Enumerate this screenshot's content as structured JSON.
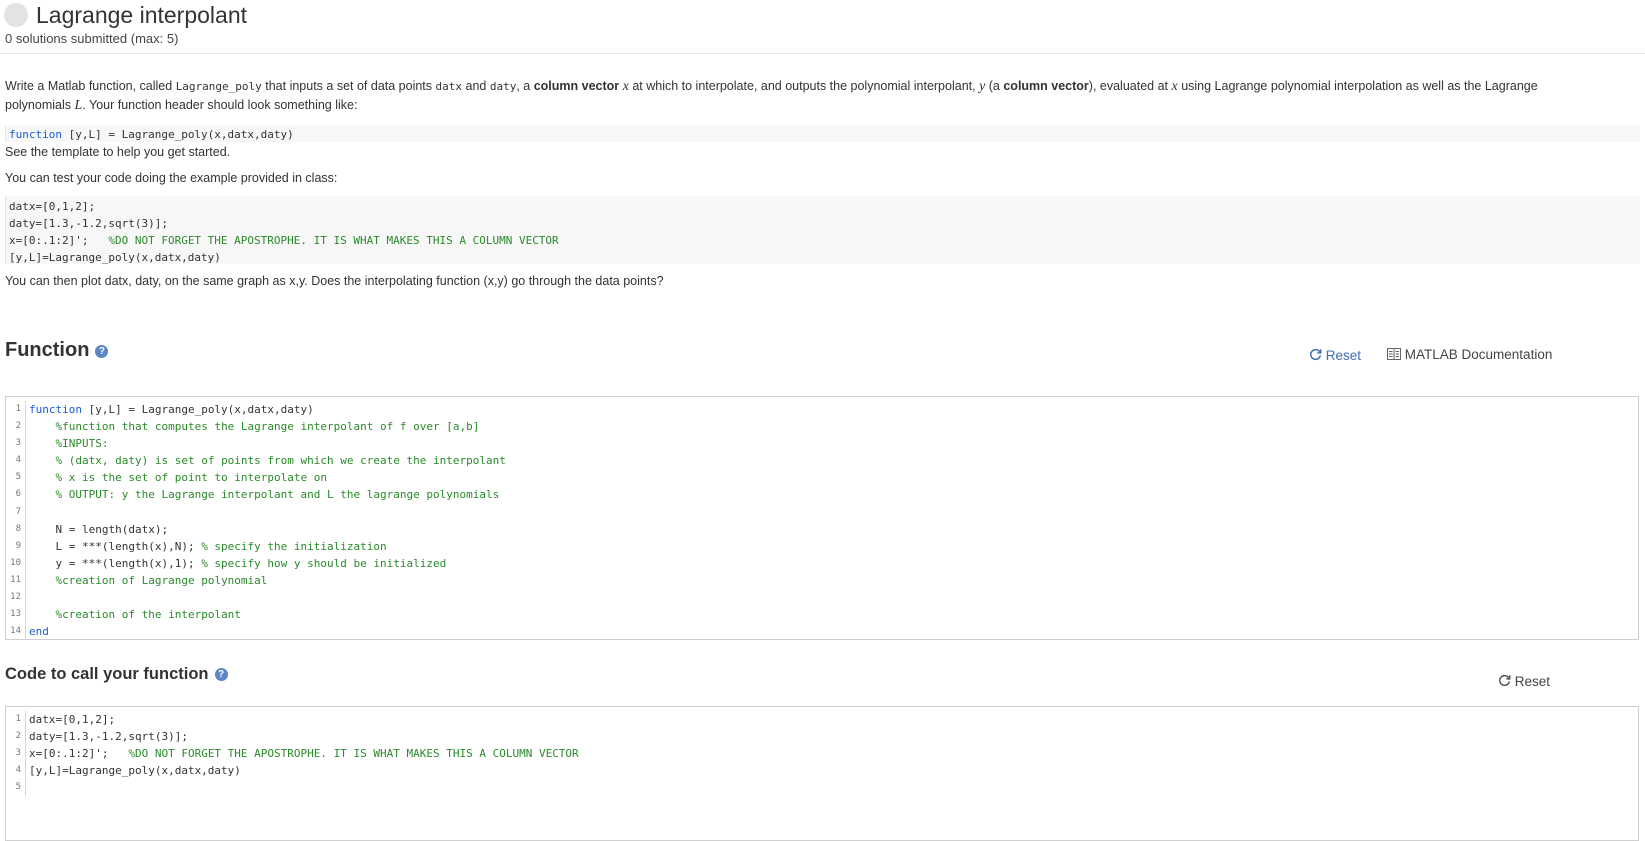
{
  "problem": {
    "title": "Lagrange interpolant",
    "submissions": "0 solutions submitted (max: 5)"
  },
  "description": {
    "p1": [
      "Write a Matlab function, called ",
      "Lagrange_poly",
      " that inputs a set of data points ",
      "datx",
      " and ",
      "daty",
      ", a ",
      "column vector",
      " ",
      "x",
      " at which to interpolate, and outputs the polynomial interpolant, ",
      "y",
      " (a ",
      "column vector",
      "), evaluated at ",
      "x",
      " using Lagrange polynomial interpolation as well as the Lagrange polynomials ",
      "L",
      ". Your function header should look something like:"
    ],
    "header_code": {
      "kw": "function",
      "rest": " [y,L] = Lagrange_poly(x,datx,daty)"
    },
    "template_note": "See the template to help you get started.",
    "test_note": "You can test your code doing the example provided in class:",
    "example": [
      {
        "code": "datx=[0,1,2];",
        "comment": ""
      },
      {
        "code": "daty=[1.3,-1.2,sqrt(3)];",
        "comment": ""
      },
      {
        "code": "x=[0:.1:2]';   ",
        "comment": "%DO NOT FORGET THE APOSTROPHE. IT IS WHAT MAKES THIS A COLUMN VECTOR"
      },
      {
        "code": "[y,L]=Lagrange_poly(x,datx,daty)",
        "comment": ""
      }
    ],
    "plot_note": "You can then plot datx, daty, on the same graph as x,y. Does the interpolating function (x,y) go through the data points?"
  },
  "function_section": {
    "title": "Function",
    "help": "?",
    "reset_label": "Reset",
    "doc_label": "MATLAB Documentation",
    "lines": [
      {
        "n": "1",
        "kw": "function",
        "code": " [y,L] = Lagrange_poly(x,datx,daty)",
        "comment": ""
      },
      {
        "n": "2",
        "kw": "",
        "code": "    ",
        "comment": "%function that computes the Lagrange interpolant of f over [a,b]"
      },
      {
        "n": "3",
        "kw": "",
        "code": "    ",
        "comment": "%INPUTS:"
      },
      {
        "n": "4",
        "kw": "",
        "code": "    ",
        "comment": "% (datx, daty) is set of points from which we create the interpolant"
      },
      {
        "n": "5",
        "kw": "",
        "code": "    ",
        "comment": "% x is the set of point to interpolate on"
      },
      {
        "n": "6",
        "kw": "",
        "code": "    ",
        "comment": "% OUTPUT: y the Lagrange interpolant and L the lagrange polynomials"
      },
      {
        "n": "7",
        "kw": "",
        "code": "",
        "comment": ""
      },
      {
        "n": "8",
        "kw": "",
        "code": "    N = length(datx);",
        "comment": ""
      },
      {
        "n": "9",
        "kw": "",
        "code": "    L = ***(length(x),N); ",
        "comment": "% specify the initialization"
      },
      {
        "n": "10",
        "kw": "",
        "code": "    y = ***(length(x),1); ",
        "comment": "% specify how y should be initialized"
      },
      {
        "n": "11",
        "kw": "",
        "code": "    ",
        "comment": "%creation of Lagrange polynomial"
      },
      {
        "n": "12",
        "kw": "",
        "code": "",
        "comment": ""
      },
      {
        "n": "13",
        "kw": "",
        "code": "    ",
        "comment": "%creation of the interpolant"
      },
      {
        "n": "14",
        "kw": "end",
        "code": "",
        "comment": ""
      }
    ]
  },
  "call_section": {
    "title": "Code to call your function",
    "help": "?",
    "reset_label": "Reset",
    "lines": [
      {
        "n": "1",
        "code": "datx=[0,1,2];",
        "comment": ""
      },
      {
        "n": "2",
        "code": "daty=[1.3,-1.2,sqrt(3)];",
        "comment": ""
      },
      {
        "n": "3",
        "code": "x=[0:.1:2]';   ",
        "comment": "%DO NOT FORGET THE APOSTROPHE. IT IS WHAT MAKES THIS A COLUMN VECTOR"
      },
      {
        "n": "4",
        "code": "[y,L]=Lagrange_poly(x,datx,daty)",
        "comment": ""
      },
      {
        "n": "5",
        "code": "",
        "comment": ""
      }
    ]
  },
  "colors": {
    "accent": "#3d6fb6",
    "keyword": "#1a5bd6",
    "comment": "#2a8a2a"
  },
  "icons": {
    "reset": "refresh-icon",
    "doc": "book-icon",
    "help": "help-icon"
  }
}
